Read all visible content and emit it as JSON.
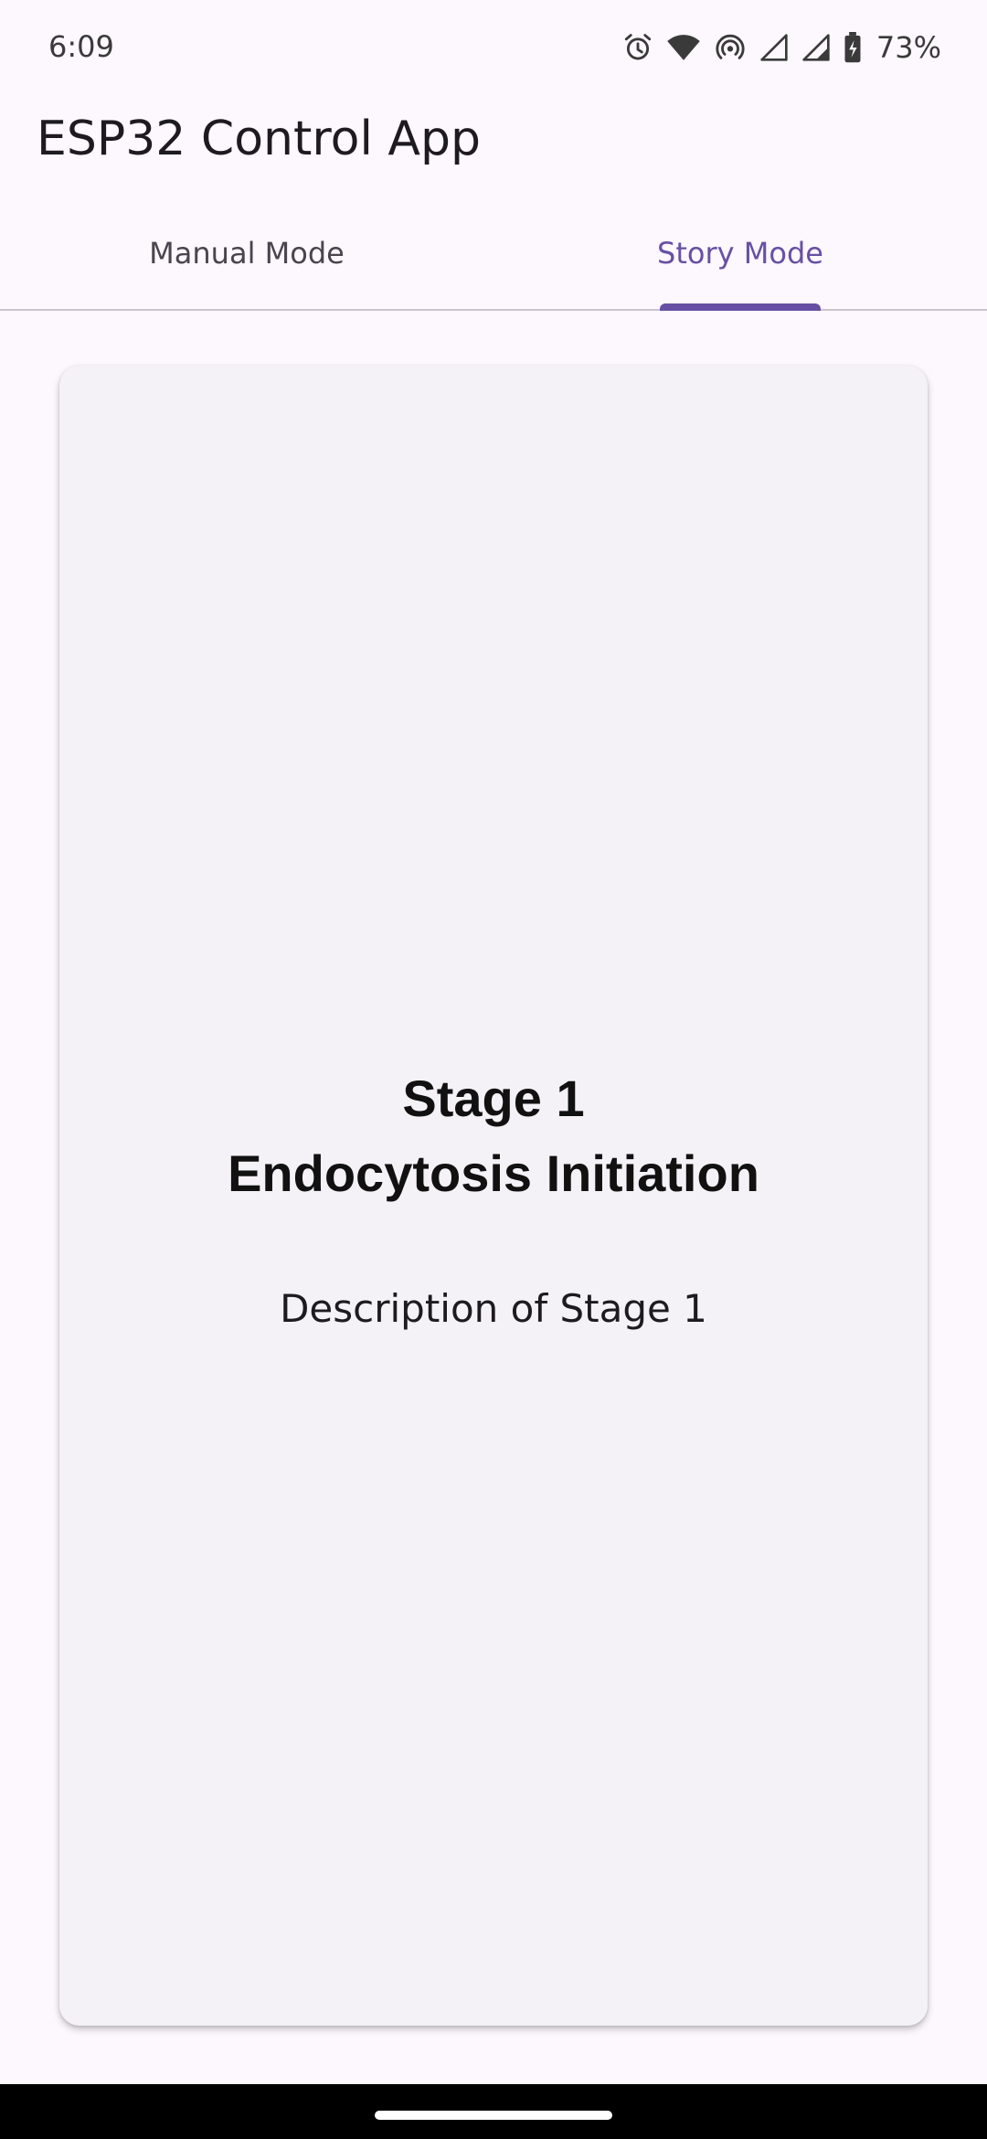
{
  "status_bar": {
    "time": "6:09",
    "battery": "73%",
    "icons": [
      "alarm-icon",
      "wifi-icon",
      "hotspot-icon",
      "signal-icon",
      "signal-icon",
      "battery-charging-icon"
    ]
  },
  "app": {
    "title": "ESP32 Control App"
  },
  "tabs": [
    {
      "label": "Manual Mode",
      "active": false
    },
    {
      "label": "Story Mode",
      "active": true
    }
  ],
  "stage": {
    "number": "Stage 1",
    "name": "Endocytosis Initiation",
    "description": "Description of Stage 1"
  },
  "colors": {
    "accent": "#6750a4",
    "background": "#fdf7fe",
    "card": "#f4f1f7"
  }
}
